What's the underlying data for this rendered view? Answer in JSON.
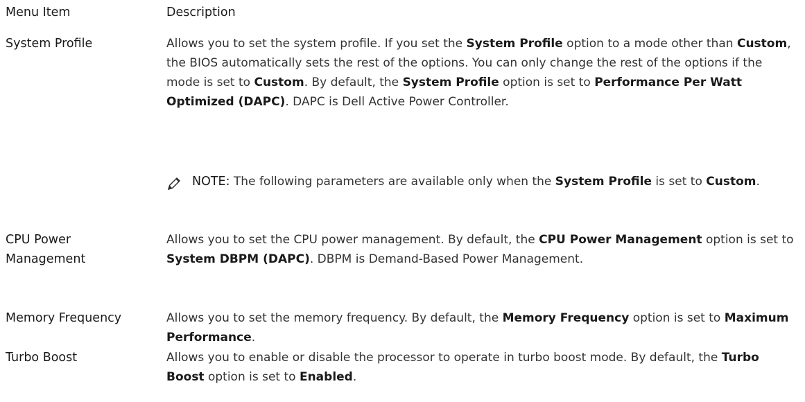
{
  "header": {
    "col1": "Menu Item",
    "col2": "Description"
  },
  "rows": [
    {
      "term": "System Profile",
      "desc": [
        {
          "t": "Allows you to set the system profile. If you set the "
        },
        {
          "t": "System Profile",
          "b": true
        },
        {
          "t": " option to a mode other than "
        },
        {
          "t": "Custom",
          "b": true
        },
        {
          "t": ", the BIOS automatically sets the rest of the options. You can only change the rest of the options if the mode is set to "
        },
        {
          "t": "Custom",
          "b": true
        },
        {
          "t": ". By default, the "
        },
        {
          "t": "System Profile",
          "b": true
        },
        {
          "t": " option is set to "
        },
        {
          "t": "Performance Per Watt Optimized (DAPC)",
          "b": true
        },
        {
          "t": ". DAPC is Dell Active Power Controller."
        }
      ],
      "note": {
        "label": "NOTE:",
        "parts": [
          {
            "t": " The following parameters are available only when the "
          },
          {
            "t": "System Profile",
            "b": true
          },
          {
            "t": " is set to "
          },
          {
            "t": "Custom",
            "b": true
          },
          {
            "t": "."
          }
        ]
      }
    },
    {
      "term": "CPU Power Management",
      "desc": [
        {
          "t": "Allows you to set the CPU power management. By default, the "
        },
        {
          "t": "CPU Power Management",
          "b": true
        },
        {
          "t": " option is set to "
        },
        {
          "t": "System DBPM (DAPC)",
          "b": true
        },
        {
          "t": ". DBPM is Demand-Based Power Management."
        }
      ]
    },
    {
      "term": "Memory Frequency",
      "desc": [
        {
          "t": "Allows you to set the memory frequency. By default, the "
        },
        {
          "t": "Memory Frequency",
          "b": true
        },
        {
          "t": " option is set to "
        },
        {
          "t": "Maximum Performance",
          "b": true
        },
        {
          "t": "."
        }
      ]
    },
    {
      "term": "Turbo Boost",
      "desc": [
        {
          "t": "Allows you to enable or disable the processor to operate in turbo boost mode. By default, the "
        },
        {
          "t": "Turbo Boost",
          "b": true
        },
        {
          "t": " option is set to "
        },
        {
          "t": "Enabled",
          "b": true
        },
        {
          "t": "."
        }
      ]
    }
  ]
}
